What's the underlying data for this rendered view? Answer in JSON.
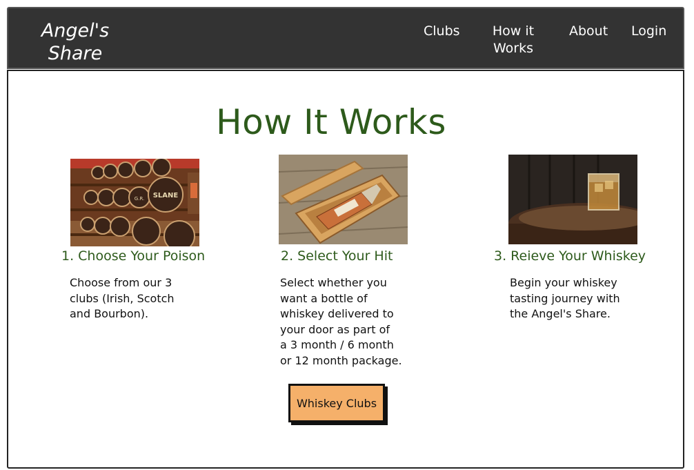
{
  "brand": {
    "line1": "Angel's",
    "line2": "Share"
  },
  "nav": {
    "clubs": "Clubs",
    "how_line1": "How it",
    "how_line2": "Works",
    "about": "About",
    "login": "Login"
  },
  "main": {
    "title": "How It Works",
    "steps": [
      {
        "title": "1. Choose Your Poison",
        "desc": [
          "Choose from our 3",
          "clubs (Irish, Scotch",
          "and Bourbon)."
        ],
        "barrel_labels": [
          "G.R.",
          "SLANE"
        ]
      },
      {
        "title": "2. Select Your Hit",
        "desc": [
          "Select whether you",
          "want a bottle of",
          "whiskey delivered to",
          "your door as part of",
          "a 3 month / 6 month",
          "or 12 month package."
        ]
      },
      {
        "title": "3. Reieve Your Whiskey",
        "desc": [
          "Begin your whiskey",
          "tasting journey with",
          "the Angel's Share."
        ]
      }
    ],
    "cta": "Whiskey Clubs"
  },
  "colors": {
    "nav_bg": "#333333",
    "title_green": "#2d5a1b",
    "button_orange": "#f5b06a"
  }
}
